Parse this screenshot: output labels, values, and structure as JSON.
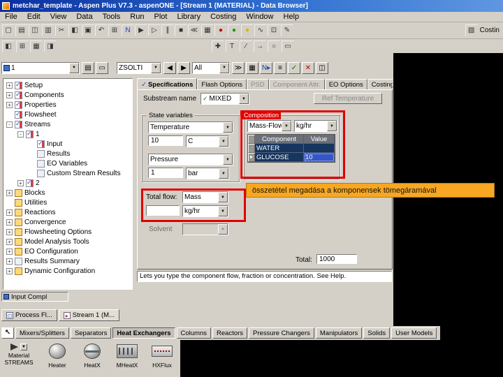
{
  "window": {
    "title": "metchar_template - Aspen Plus V7.3 - aspenONE - [Stream 1 (MATERIAL) - Data Browser]"
  },
  "menu": {
    "items": [
      {
        "label": "File"
      },
      {
        "label": "Edit"
      },
      {
        "label": "View"
      },
      {
        "label": "Data"
      },
      {
        "label": "Tools"
      },
      {
        "label": "Run"
      },
      {
        "label": "Plot"
      },
      {
        "label": "Library"
      },
      {
        "label": "Costing"
      },
      {
        "label": "Window"
      },
      {
        "label": "Help"
      }
    ]
  },
  "toolbar_main": {
    "icons": [
      {
        "name": "new-icon",
        "glyph": "▢"
      },
      {
        "name": "open-icon",
        "glyph": "▤"
      },
      {
        "name": "save-icon",
        "glyph": "◫"
      },
      {
        "name": "print-icon",
        "glyph": "▥"
      },
      {
        "name": "cut-icon",
        "glyph": "✂"
      },
      {
        "name": "copy-icon",
        "glyph": "◧"
      },
      {
        "name": "paste-icon",
        "glyph": "▣"
      },
      {
        "name": "undo-icon",
        "glyph": "↶"
      },
      {
        "name": "data-browser-icon",
        "glyph": "⊞"
      },
      {
        "name": "next-input-icon",
        "glyph": "N",
        "color": "#1a3fbf"
      },
      {
        "name": "run-icon",
        "glyph": "▶"
      },
      {
        "name": "step-icon",
        "glyph": "▷"
      },
      {
        "name": "pause-icon",
        "glyph": "∥"
      },
      {
        "name": "stop-icon",
        "glyph": "■"
      },
      {
        "name": "reinitialize-icon",
        "glyph": "≪"
      },
      {
        "name": "control-panel-icon",
        "glyph": "▦"
      },
      {
        "name": "status-stop-icon",
        "glyph": "●",
        "color": "#cc0000"
      },
      {
        "name": "status-run-icon",
        "glyph": "●",
        "color": "#00a000"
      },
      {
        "name": "status-wait-icon",
        "glyph": "●",
        "color": "#d8b400"
      },
      {
        "name": "plot-icon",
        "glyph": "∿"
      },
      {
        "name": "flowsheet-icon",
        "glyph": "⊡"
      },
      {
        "name": "annotate-icon",
        "glyph": "✎"
      }
    ],
    "right_label": "Costin"
  },
  "toolbar_secondary": {
    "left_icons": [
      {
        "name": "workbook-icon",
        "glyph": "◧"
      },
      {
        "name": "grid-icon",
        "glyph": "⊞"
      },
      {
        "name": "form-icon",
        "glyph": "▦"
      },
      {
        "name": "split-view-icon",
        "glyph": "◨"
      }
    ],
    "right_icons": [
      {
        "name": "select-tool-icon",
        "glyph": "✚"
      },
      {
        "name": "text-tool-icon",
        "glyph": "T"
      },
      {
        "name": "line-tool-icon",
        "glyph": "∕"
      },
      {
        "name": "arrow-tool-icon",
        "glyph": "→"
      },
      {
        "name": "oval-tool-icon",
        "glyph": "○"
      },
      {
        "name": "rect-tool-icon",
        "glyph": "▭"
      }
    ]
  },
  "browser_bar": {
    "object_value": "1",
    "units_value": "ZSOLTI",
    "filter_value": "All",
    "left_icons": [
      {
        "name": "form-list-icon",
        "glyph": "▤"
      },
      {
        "name": "comments-icon",
        "glyph": "▭"
      }
    ],
    "nav_icons": [
      {
        "name": "back-icon",
        "glyph": "◀"
      },
      {
        "name": "forward-icon",
        "glyph": "▶"
      }
    ],
    "trail_icons": [
      {
        "name": "advance-icon",
        "glyph": "≫"
      },
      {
        "name": "model-palette-icon",
        "glyph": "▦"
      },
      {
        "name": "next-input-icon",
        "glyph": "N▸",
        "color": "#1a3fbf"
      },
      {
        "name": "eo-view-icon",
        "glyph": "≡"
      },
      {
        "name": "check-status-icon",
        "glyph": "✓",
        "color": "#00780a"
      },
      {
        "name": "delete-icon",
        "glyph": "✕",
        "color": "#c00000"
      },
      {
        "name": "copy-object-icon",
        "glyph": "◫"
      }
    ]
  },
  "tree": {
    "items": [
      {
        "label": "Setup",
        "exp": "+",
        "icon": "check",
        "level": 0
      },
      {
        "label": "Components",
        "exp": "+",
        "icon": "check",
        "level": 0
      },
      {
        "label": "Properties",
        "exp": "+",
        "icon": "check",
        "level": 0
      },
      {
        "label": "Flowsheet",
        "exp": "",
        "icon": "check",
        "level": 0
      },
      {
        "label": "Streams",
        "exp": "-",
        "icon": "check",
        "level": 0
      },
      {
        "label": "1",
        "exp": "-",
        "icon": "check",
        "level": 1
      },
      {
        "label": "Input",
        "exp": "",
        "icon": "check",
        "level": 2
      },
      {
        "label": "Results",
        "exp": "",
        "icon": "sheet",
        "level": 2
      },
      {
        "label": "EO Variables",
        "exp": "",
        "icon": "sheet",
        "level": 2
      },
      {
        "label": "Custom Stream Results",
        "exp": "",
        "icon": "sheet",
        "level": 2
      },
      {
        "label": "2",
        "exp": "+",
        "icon": "check",
        "level": 1
      },
      {
        "label": "Blocks",
        "exp": "+",
        "icon": "folder",
        "level": 0
      },
      {
        "label": "Utilities",
        "exp": "",
        "icon": "folder",
        "level": 0
      },
      {
        "label": "Reactions",
        "exp": "+",
        "icon": "folder",
        "level": 0
      },
      {
        "label": "Convergence",
        "exp": "+",
        "icon": "folder",
        "level": 0
      },
      {
        "label": "Flowsheeting Options",
        "exp": "+",
        "icon": "folder",
        "level": 0
      },
      {
        "label": "Model Analysis Tools",
        "exp": "+",
        "icon": "folder",
        "level": 0
      },
      {
        "label": "EO Configuration",
        "exp": "+",
        "icon": "folder",
        "level": 0
      },
      {
        "label": "Results Summary",
        "exp": "+",
        "icon": "sheet",
        "level": 0
      },
      {
        "label": "Dynamic Configuration",
        "exp": "+",
        "icon": "folder",
        "level": 0
      }
    ]
  },
  "form": {
    "tabs": [
      {
        "label": "Specifications",
        "active": true,
        "checked": true
      },
      {
        "label": "Flash Options"
      },
      {
        "label": "PSD",
        "disabled": true
      },
      {
        "label": "Component Attr.",
        "disabled": true
      },
      {
        "label": "EO Options"
      },
      {
        "label": "Costing"
      }
    ],
    "substream_label": "Substream name",
    "substream_value": "MIXED",
    "ref_temp_button": "Ref Temperature",
    "state_group": {
      "label": "State variables",
      "var1": "Temperature",
      "var1_value": "10",
      "var1_unit": "C",
      "var2": "Pressure",
      "var2_value": "1",
      "var2_unit": "bar"
    },
    "composition_group": {
      "label": "Composition",
      "basis": "Mass-Flow",
      "unit": "kg/hr",
      "grid": {
        "headers": [
          "Component",
          "Value"
        ],
        "rows": [
          {
            "marker": "",
            "component": "WATER",
            "value": ""
          },
          {
            "marker": "▸",
            "component": "GLUCOSE",
            "value": "10",
            "selected": true
          }
        ]
      }
    },
    "total_flow": {
      "label": "Total flow:",
      "basis": "Mass",
      "value": "",
      "unit": "kg/hr"
    },
    "solvent_label": "Solvent",
    "total_label": "Total:",
    "total_value": "1000",
    "help_text": "Lets you type the component flow, fraction or concentration. See Help."
  },
  "annotation": {
    "text": "összetétel megadása a komponensek tömegáramával"
  },
  "statusbar": {
    "text": "Input Compl"
  },
  "window_tabs": {
    "items": [
      {
        "label": "Process Fl...",
        "icon": "flowsheet"
      },
      {
        "label": "Stream 1 (M...",
        "icon": "stream",
        "active": true
      }
    ]
  },
  "palette": {
    "tabs": [
      {
        "label": "Mixers/Splitters"
      },
      {
        "label": "Separators"
      },
      {
        "label": "Heat Exchangers",
        "active": true
      },
      {
        "label": "Columns"
      },
      {
        "label": "Reactors"
      },
      {
        "label": "Pressure Changers"
      },
      {
        "label": "Manipulators"
      },
      {
        "label": "Solids"
      },
      {
        "label": "User Models"
      }
    ],
    "stream_selector": {
      "label_top": "Material",
      "label_bottom": "STREAMS"
    },
    "models": [
      {
        "name": "model-heater",
        "label": "Heater",
        "icon": "sphere"
      },
      {
        "name": "model-heatx",
        "label": "HeatX",
        "icon": "sphere-x"
      },
      {
        "name": "model-mheatx",
        "label": "MHeatX",
        "icon": "zigzag"
      },
      {
        "name": "model-hxflux",
        "label": "HXFlux",
        "icon": "flux"
      }
    ]
  }
}
